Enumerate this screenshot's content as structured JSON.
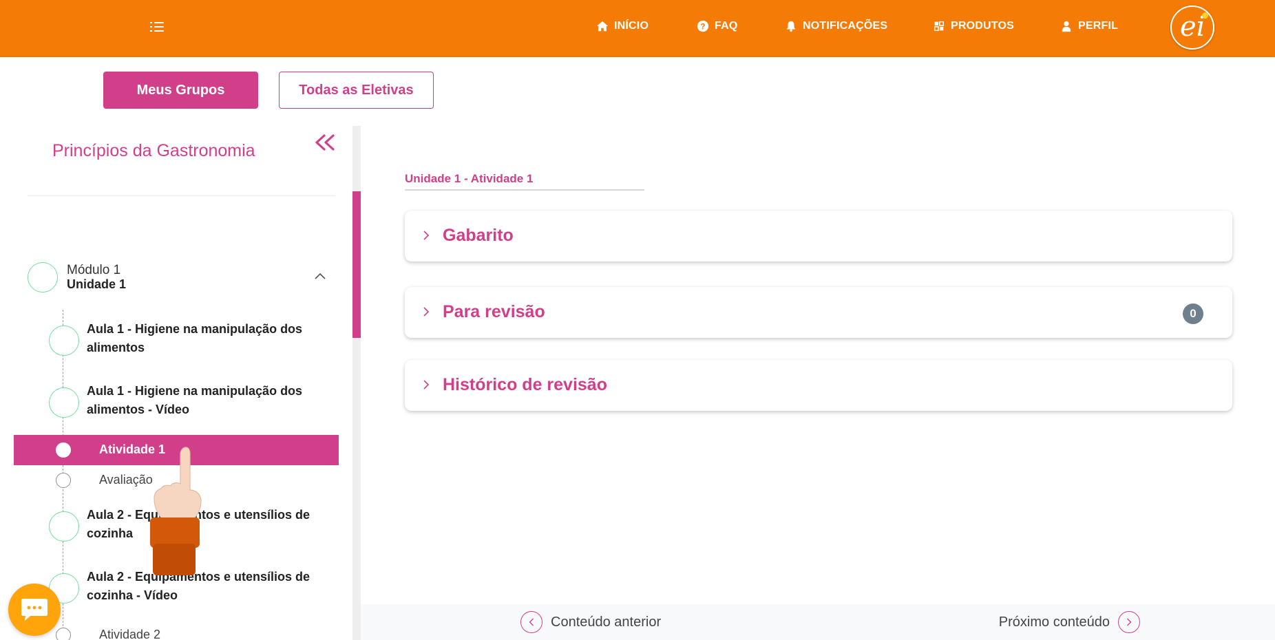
{
  "topbar": {
    "nav": [
      {
        "label": "INÍCIO",
        "icon": "home-icon"
      },
      {
        "label": "FAQ",
        "icon": "question-circle-icon"
      },
      {
        "label": "NOTIFICAÇÕES",
        "icon": "bell-icon"
      },
      {
        "label": "PRODUTOS",
        "icon": "products-icon"
      },
      {
        "label": "PERFIL",
        "icon": "user-icon"
      }
    ],
    "logo_text": "ei",
    "color": "#f47c06"
  },
  "subbar": {
    "primary_label": "Meus Grupos",
    "secondary_label": "Todas as Eletivas",
    "accent": "#d13f8a"
  },
  "sidebar": {
    "course_title": "Princípios da Gastronomia",
    "module": {
      "label": "Módulo 1",
      "sub": "Unidade 1"
    },
    "items": [
      {
        "label": "Aula 1 - Higiene na manipulação dos alimentos"
      },
      {
        "label": "Aula 1 - Higiene na manipulação dos alimentos - Vídeo"
      },
      {
        "label": "Atividade 1",
        "active": true
      },
      {
        "label": "Avaliação"
      },
      {
        "label": "Aula 2 - Equipamentos e utensílios de cozinha"
      },
      {
        "label": "Aula 2 - Equipamentos e utensílios de cozinha - Vídeo"
      },
      {
        "label": "Atividade 2"
      }
    ]
  },
  "main": {
    "breadcrumb": "Unidade 1 - Atividade 1",
    "panels": [
      {
        "title": "Gabarito"
      },
      {
        "title": "Para revisão",
        "badge": "0"
      },
      {
        "title": "Histórico de revisão"
      }
    ],
    "footer": {
      "prev_label": "Conteúdo anterior",
      "next_label": "Próximo conteúdo"
    }
  }
}
